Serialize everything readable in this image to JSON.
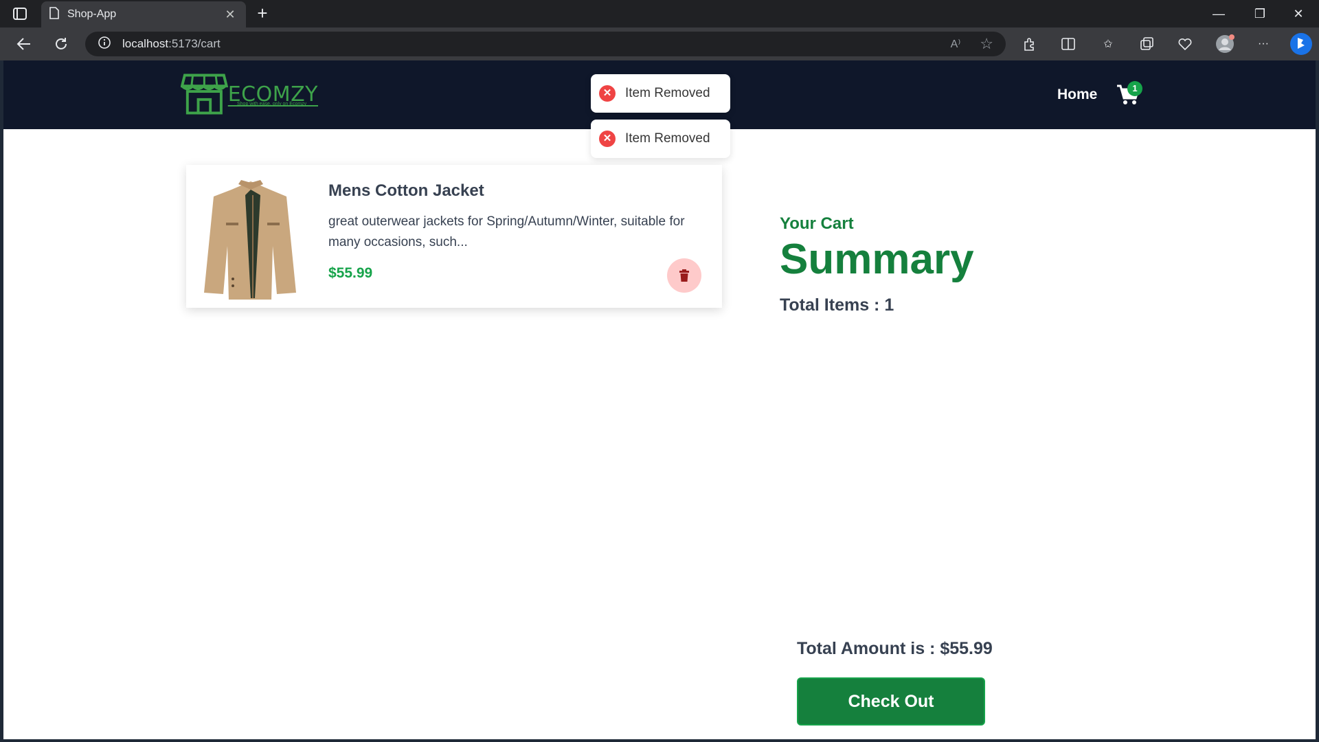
{
  "browser": {
    "tab_title": "Shop-App",
    "url_host": "localhost",
    "url_path": ":5173/cart",
    "new_tab_label": "+"
  },
  "navbar": {
    "logo_text": "ECOMZY",
    "logo_tagline": "Shop with ease, only on Ecomzy",
    "home_label": "Home",
    "cart_count": "1"
  },
  "toasts": [
    {
      "text": "Item Removed"
    },
    {
      "text": "Item Removed"
    }
  ],
  "cart_item": {
    "title": "Mens Cotton Jacket",
    "description": "great outerwear jackets for Spring/Autumn/Winter, suitable for many occasions, such...",
    "price": "$55.99"
  },
  "summary": {
    "your_cart": "Your Cart",
    "heading": "Summary",
    "total_items": "Total Items : 1",
    "total_amount": "Total Amount is : $55.99",
    "checkout_label": "Check Out"
  },
  "colors": {
    "brand_green": "#15803d",
    "price_green": "#16a34a",
    "navbar_bg": "#0f172a",
    "toast_error": "#ef4444",
    "delete_bg": "#fecaca"
  }
}
